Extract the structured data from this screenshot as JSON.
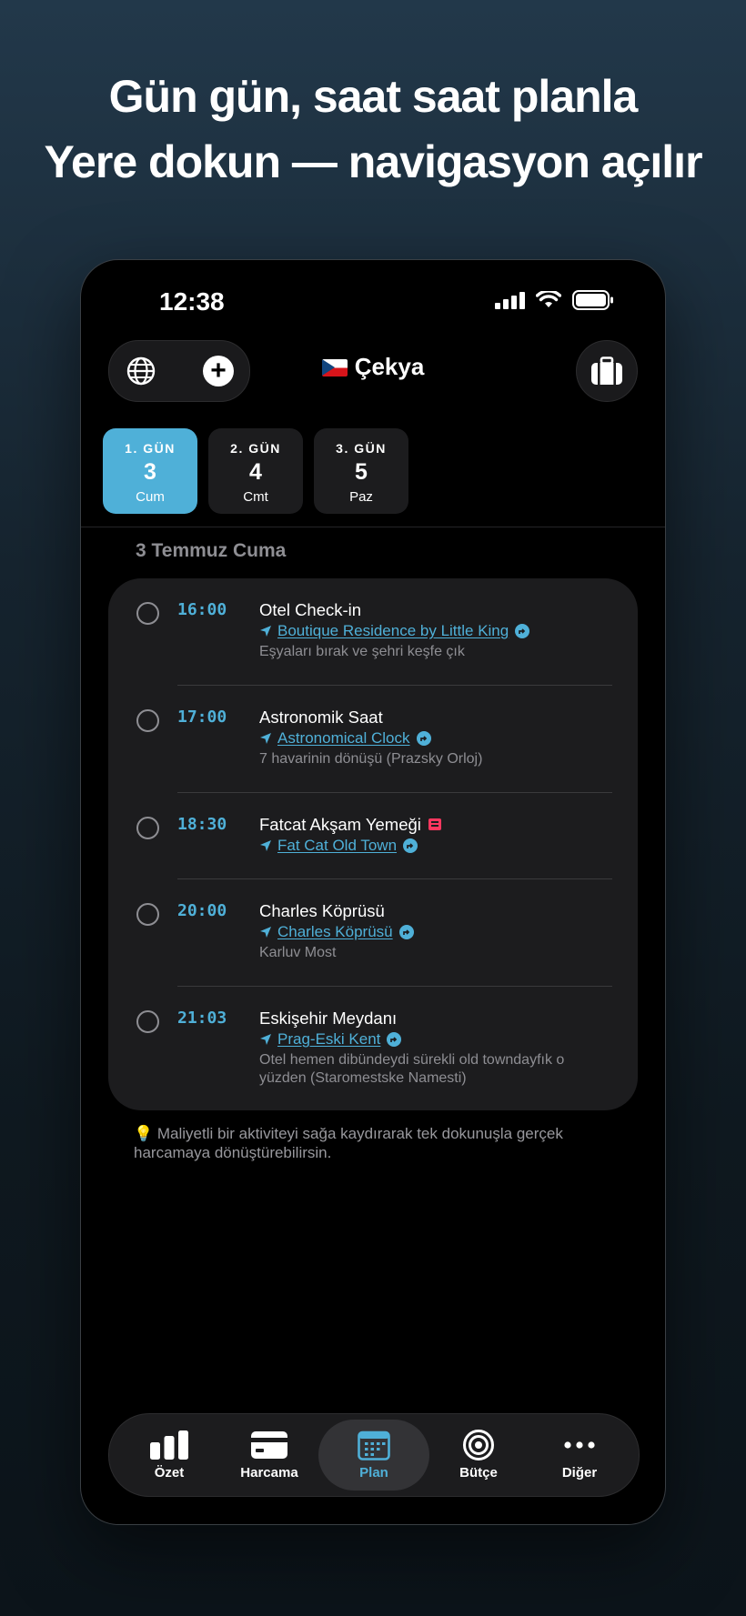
{
  "headline": {
    "line1": "Gün gün, saat saat planla",
    "line2": "Yere dokun — navigasyon açılır"
  },
  "status_bar": {
    "time": "12:38"
  },
  "header": {
    "country": "Çekya",
    "flag": "czech-flag"
  },
  "days": [
    {
      "label": "1. GÜN",
      "date": "3",
      "weekday": "Cum",
      "active": true
    },
    {
      "label": "2. GÜN",
      "date": "4",
      "weekday": "Cmt",
      "active": false
    },
    {
      "label": "3. GÜN",
      "date": "5",
      "weekday": "Paz",
      "active": false
    }
  ],
  "date_heading": "3 Temmuz Cuma",
  "items": [
    {
      "time": "16:00",
      "title": "Otel Check-in",
      "location": "Boutique Residence by Little King",
      "note": "Eşyaları bırak ve şehri keşfe çık"
    },
    {
      "time": "17:00",
      "title": "Astronomik Saat",
      "location": "Astronomical Clock",
      "note": "7 havarinin dönüşü (Prazsky Orloj)"
    },
    {
      "time": "18:30",
      "title": "Fatcat Akşam Yemeği",
      "location": "Fat Cat Old Town",
      "note": ""
    },
    {
      "time": "20:00",
      "title": "Charles Köprüsü",
      "location": "Charles Köprüsü",
      "note": "Karluv Most"
    },
    {
      "time": "21:03",
      "title": "Eskişehir Meydanı",
      "location": "Prag-Eski Kent",
      "note": "Otel hemen dibündeydi sürekli old towndayfık o yüzden (Staromestske Namesti)"
    }
  ],
  "tip": "💡 Maliyetli bir aktiviteyi sağa kaydırarak tek dokunuşla gerçek harcamaya dönüştürebilirsin.",
  "tabs": [
    {
      "label": "Özet",
      "icon": "bar-chart-icon"
    },
    {
      "label": "Harcama",
      "icon": "card-icon"
    },
    {
      "label": "Plan",
      "icon": "calendar-icon",
      "active": true
    },
    {
      "label": "Bütçe",
      "icon": "target-icon"
    },
    {
      "label": "Diğer",
      "icon": "more-icon"
    }
  ],
  "colors": {
    "accent": "#4fb0d8",
    "card": "#1c1c1e",
    "badge": "#ff375f"
  }
}
